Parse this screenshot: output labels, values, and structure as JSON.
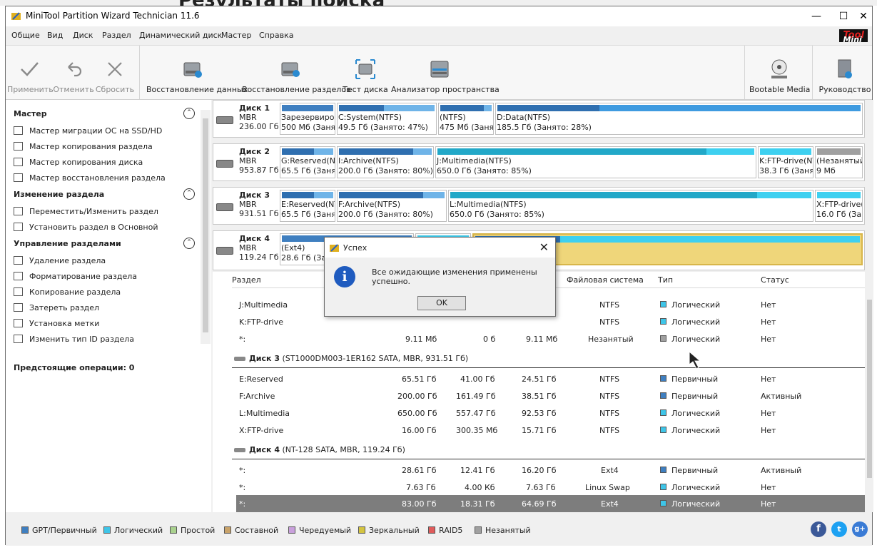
{
  "background": {
    "title": "Результаты поиска"
  },
  "window": {
    "title": "MiniTool Partition Wizard Technician 11.6",
    "logo_a": "Mini",
    "logo_b": "Tool"
  },
  "menu": [
    "Общие",
    "Вид",
    "Диск",
    "Раздел",
    "Динамический диск",
    "Мастер",
    "Справка"
  ],
  "toolbar": {
    "apply": "Применить",
    "undo": "Отменить",
    "discard": "Сбросить",
    "data_recovery": "Восстановление данных",
    "partition_recovery": "Восстановление разделов",
    "disk_test": "Тест диска",
    "space_analyzer": "Анализатор пространства",
    "bootable": "Bootable Media",
    "manual": "Руководство"
  },
  "sidebar": {
    "wizard_head": "Мастер",
    "wizard_items": [
      "Мастер миграции ОС на SSD/HD",
      "Мастер копирования раздела",
      "Мастер копирования диска",
      "Мастер восстановления раздела"
    ],
    "change_head": "Изменение раздела",
    "change_items": [
      "Переместить/Изменить раздел",
      "Установить раздел в Основной"
    ],
    "manage_head": "Управление разделами",
    "manage_items": [
      "Удаление раздела",
      "Форматирование раздела",
      "Копирование раздела",
      "Затереть раздел",
      "Установка метки",
      "Изменить тип ID раздела"
    ],
    "pending": "Предстоящие операции: 0"
  },
  "disks": [
    {
      "name": "Диск 1",
      "type": "MBR",
      "size": "236.00 Гб",
      "parts": [
        {
          "l1": "Зарезервиро",
          "l2": "500 Мб (Занято"
        },
        {
          "l1": "C:System(NTFS)",
          "l2": "49.5 Гб (Занято: 47%)"
        },
        {
          "l1": "(NTFS)",
          "l2": "475 Мб (Занят"
        },
        {
          "l1": "D:Data(NTFS)",
          "l2": "185.5 Гб (Занято: 28%)"
        }
      ]
    },
    {
      "name": "Диск 2",
      "type": "MBR",
      "size": "953.87 Гб",
      "parts": [
        {
          "l1": "G:Reserved(NTF",
          "l2": "65.5 Гб (Занято"
        },
        {
          "l1": "I:Archive(NTFS)",
          "l2": "200.0 Гб (Занято: 80%)"
        },
        {
          "l1": "J:Multimedia(NTFS)",
          "l2": "650.0 Гб (Занято: 85%)"
        },
        {
          "l1": "K:FTP-drive(NTF",
          "l2": "38.3 Гб (Занято"
        },
        {
          "l1": "(Незанятый)",
          "l2": "9 Мб"
        }
      ]
    },
    {
      "name": "Диск 3",
      "type": "MBR",
      "size": "931.51 Гб",
      "parts": [
        {
          "l1": "E:Reserved(NTF",
          "l2": "65.5 Гб (Занято"
        },
        {
          "l1": "F:Archive(NTFS)",
          "l2": "200.0 Гб (Занято: 80%)"
        },
        {
          "l1": "L:Multimedia(NTFS)",
          "l2": "650.0 Гб (Занято: 85%)"
        },
        {
          "l1": "X:FTP-drive(NTF",
          "l2": "16.0 Гб (Занято"
        }
      ]
    },
    {
      "name": "Диск 4",
      "type": "MBR",
      "size": "119.24 Гб",
      "parts": [
        {
          "l1": "(Ext4)",
          "l2": "28.6 Гб (Занято"
        },
        {
          "l1": "",
          "l2": ""
        },
        {
          "l1": "",
          "l2": ""
        }
      ]
    }
  ],
  "table": {
    "headers": [
      "Раздел",
      "Файловая система",
      "Тип",
      "Статус"
    ],
    "rows_top": [
      {
        "part": "J:Multimedia",
        "fs": "NTFS",
        "type": "Логический",
        "status": "Нет"
      },
      {
        "part": "K:FTP-drive",
        "fs": "NTFS",
        "type": "Логический",
        "status": "Нет"
      },
      {
        "part": "*:",
        "cap": "9.11 Мб",
        "used": "0 б",
        "free": "9.11 Мб",
        "fs": "Незанятый",
        "type": "Логический",
        "status": "Нет"
      }
    ],
    "disk3_label": "Диск 3",
    "disk3_desc": "(ST1000DM003-1ER162 SATA, MBR, 931.51 Гб)",
    "rows_d3": [
      {
        "part": "E:Reserved",
        "cap": "65.51 Гб",
        "used": "41.00 Гб",
        "free": "24.51 Гб",
        "fs": "NTFS",
        "type": "Первичный",
        "status": "Нет"
      },
      {
        "part": "F:Archive",
        "cap": "200.00 Гб",
        "used": "161.49 Гб",
        "free": "38.51 Гб",
        "fs": "NTFS",
        "type": "Первичный",
        "status": "Активный"
      },
      {
        "part": "L:Multimedia",
        "cap": "650.00 Гб",
        "used": "557.47 Гб",
        "free": "92.53 Гб",
        "fs": "NTFS",
        "type": "Логический",
        "status": "Нет"
      },
      {
        "part": "X:FTP-drive",
        "cap": "16.00 Гб",
        "used": "300.35 Мб",
        "free": "15.71 Гб",
        "fs": "NTFS",
        "type": "Логический",
        "status": "Нет"
      }
    ],
    "disk4_label": "Диск 4",
    "disk4_desc": "(NT-128 SATA, MBR, 119.24 Гб)",
    "rows_d4": [
      {
        "part": "*:",
        "cap": "28.61 Гб",
        "used": "12.41 Гб",
        "free": "16.20 Гб",
        "fs": "Ext4",
        "type": "Первичный",
        "status": "Активный"
      },
      {
        "part": "*:",
        "cap": "7.63 Гб",
        "used": "4.00 Кб",
        "free": "7.63 Гб",
        "fs": "Linux Swap",
        "type": "Логический",
        "status": "Нет"
      },
      {
        "part": "*:",
        "cap": "83.00 Гб",
        "used": "18.31 Гб",
        "free": "64.69 Гб",
        "fs": "Ext4",
        "type": "Логический",
        "status": "Нет"
      }
    ]
  },
  "legend": [
    "GPT/Первичный",
    "Логический",
    "Простой",
    "Составной",
    "Чередуемый",
    "Зеркальный",
    "RAID5",
    "Незанятый"
  ],
  "legend_colors": [
    "#3f7fc0",
    "#3ec5e8",
    "#a9d18e",
    "#c9a36a",
    "#c9a0dc",
    "#d4c440",
    "#e05b5b",
    "#a0a0a0"
  ],
  "dialog": {
    "title": "Успех",
    "message": "Все ожидающие изменения применены успешно.",
    "ok": "OK"
  },
  "colors": {
    "primary_bar": "#3f7fc0",
    "logical_bar": "#3ec5e8",
    "selected_part": "#efd67a"
  }
}
